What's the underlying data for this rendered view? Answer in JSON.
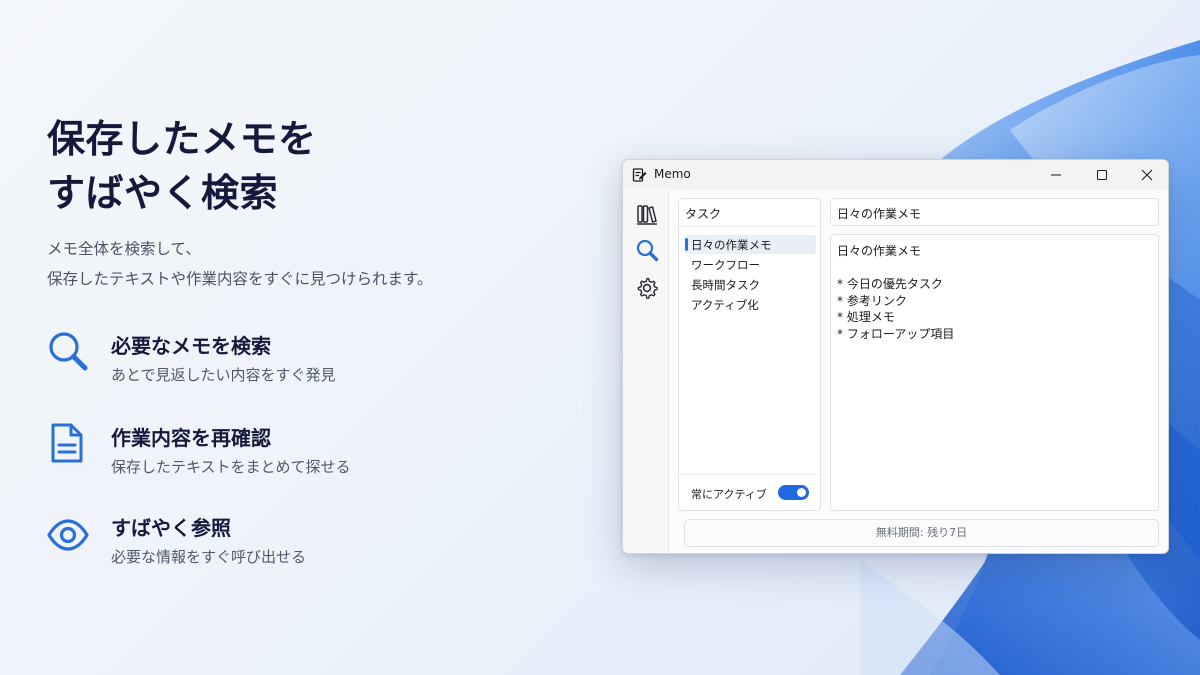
{
  "hero": {
    "title_line1": "保存したメモを",
    "title_line2": "すばやく検索",
    "subtitle_line1": "メモ全体を検索して、",
    "subtitle_line2": "保存したテキストや作業内容をすぐに見つけられます。"
  },
  "features": [
    {
      "icon": "search-icon",
      "title": "必要なメモを検索",
      "desc": "あとで見返したい内容をすぐ発見"
    },
    {
      "icon": "document-icon",
      "title": "作業内容を再確認",
      "desc": "保存したテキストをまとめて探せる"
    },
    {
      "icon": "eye-icon",
      "title": "すばやく参照",
      "desc": "必要な情報をすぐ呼び出せる"
    }
  ],
  "window": {
    "title": "Memo",
    "list_header": "タスク",
    "items": [
      "日々の作業メモ",
      "ワークフロー",
      "長時間タスク",
      "アクティブ化"
    ],
    "selected_index": 0,
    "always_active_label": "常にアクティブ",
    "always_active_on": true,
    "memo_title": "日々の作業メモ",
    "memo_body": [
      "日々の作業メモ",
      "",
      "* 今日の優先タスク",
      "* 参考リンク",
      "* 処理メモ",
      "* フォローアップ項目"
    ],
    "status": "無料期間: 残り7日"
  },
  "colors": {
    "accent": "#1f6ae0",
    "heading": "#151a3d",
    "icon_blue": "#2a6fd6"
  }
}
